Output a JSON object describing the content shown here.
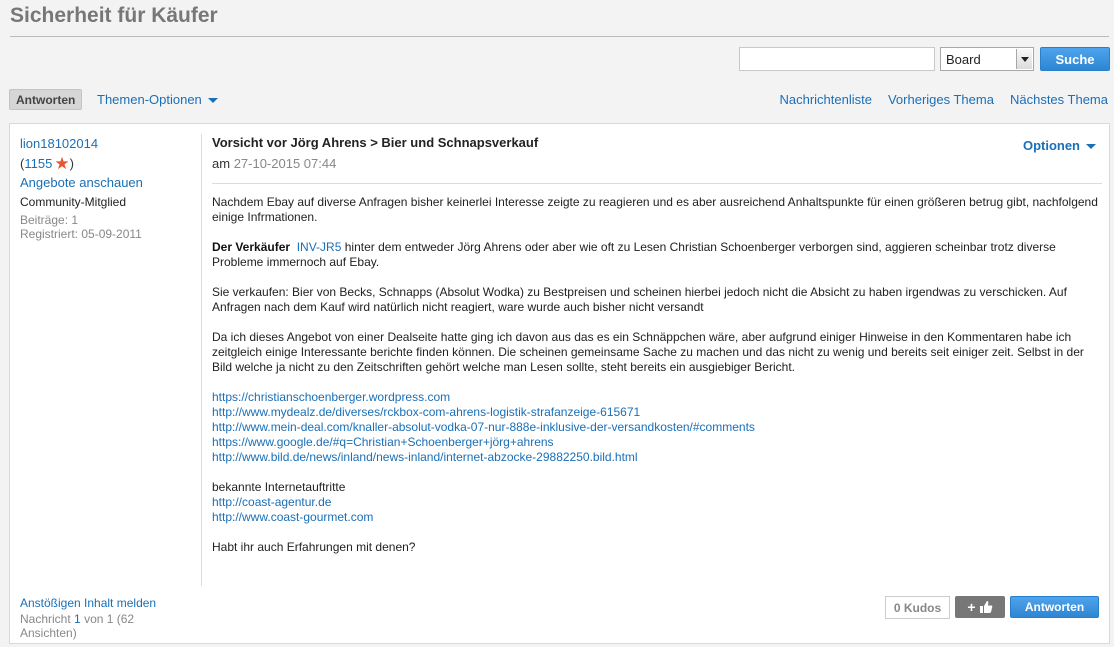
{
  "page": {
    "title": "Sicherheit für Käufer"
  },
  "search": {
    "value": "",
    "scope": "Board",
    "button": "Suche"
  },
  "toolbar": {
    "reply": "Antworten",
    "topic_options": "Themen-Optionen",
    "nav": [
      "Nachrichtenliste",
      "Vorheriges Thema",
      "Nächstes Thema"
    ]
  },
  "post": {
    "author": {
      "name": "lion18102014",
      "kudos": "1155",
      "offers": "Angebote anschauen",
      "rank": "Community-Mitglied",
      "posts": "Beiträge: 1",
      "registered": "Registriert: 05-09-2011"
    },
    "subject": "Vorsicht vor Jörg Ahrens > Bier und Schnapsverkauf",
    "date_prefix": "am",
    "date": "27-10-2015 07:44",
    "options": "Optionen",
    "body": {
      "p1": "Nachdem Ebay auf diverse Anfragen bisher keinerlei Interesse zeigte zu reagieren und es aber ausreichend Anhaltspunkte für einen größeren betrug gibt, nachfolgend einige Infrmationen.",
      "p2_bold": "Der Verkäufer",
      "p2_link": "INV-JR5",
      "p2_rest": "hinter dem entweder Jörg Ahrens oder aber wie oft zu Lesen Christian Schoenberger verborgen sind, aggieren scheinbar trotz diverse Probleme immernoch auf Ebay.",
      "p3": "Sie verkaufen: Bier von Becks, Schnapps (Absolut Wodka) zu Bestpreisen und scheinen hierbei jedoch nicht die Absicht zu haben irgendwas zu verschicken. Auf Anfragen nach dem Kauf wird natürlich nicht reagiert, ware wurde auch bisher nicht versandt",
      "p4": "Da ich dieses Angebot von einer Dealseite hatte ging ich davon aus das es ein Schnäppchen wäre, aber aufgrund einiger Hinweise in den Kommentaren habe ich zeitgleich einige Interessante berichte finden können. Die scheinen gemeinsame Sache zu machen und das nicht zu wenig und bereits seit einiger zeit. Selbst in der Bild welche ja nicht zu den Zeitschriften gehört welche man Lesen sollte, steht bereits ein ausgiebiger Bericht.",
      "links": [
        "https://christianschoenberger.wordpress.com",
        "http://www.mydealz.de/diverses/rckbox-com-ahrens-logistik-strafanzeige-615671",
        "http://www.mein-deal.com/knaller-absolut-vodka-07-nur-888e-inklusive-der-versandkosten/#comments",
        "https://www.google.de/#q=Christian+Schoenberger+jörg+ahrens",
        "http://www.bild.de/news/inland/news-inland/internet-abzocke-29882250.bild.html"
      ],
      "known_label": "bekannte Internetauftritte",
      "known_links": [
        "http://coast-agentur.de",
        "http://www.coast-gourmet.com"
      ],
      "question": "Habt ihr auch Erfahrungen mit denen?"
    },
    "footer": {
      "report": "Anstößigen Inhalt melden",
      "msg_prefix": "Nachricht",
      "msg_num": "1",
      "msg_suffix": "von 1 (62 Ansichten)",
      "kudos": "0 Kudos",
      "kudo_plus": "+",
      "reply": "Antworten"
    }
  }
}
